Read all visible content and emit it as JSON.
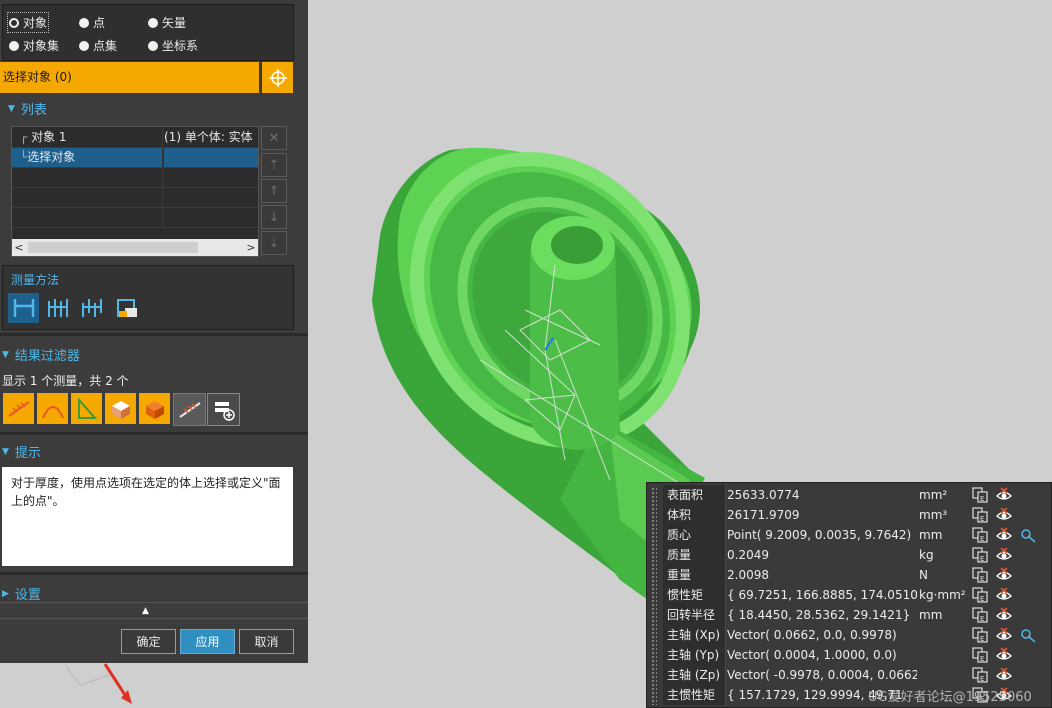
{
  "selection_types": [
    {
      "label": "对象",
      "checked": true
    },
    {
      "label": "点",
      "checked": false
    },
    {
      "label": "矢量",
      "checked": false
    },
    {
      "label": "对象集",
      "checked": false
    },
    {
      "label": "点集",
      "checked": false
    },
    {
      "label": "坐标系",
      "checked": false
    }
  ],
  "select_bar": {
    "label": "选择对象 (0)",
    "target_icon": "crosshair-icon"
  },
  "list_section": {
    "title": "列表",
    "rows": [
      {
        "name": "对象 1",
        "info": "(1) 单个体: 实体"
      },
      {
        "name": "选择对象",
        "info": ""
      }
    ],
    "side_buttons": [
      "delete-icon",
      "move-top-icon",
      "move-up-icon",
      "move-down-icon",
      "move-bottom-icon"
    ]
  },
  "method_section": {
    "title": "测量方法",
    "buttons": [
      "distance-icon",
      "multi-distance-icon",
      "chain-distance-icon",
      "mass-properties-icon"
    ]
  },
  "filter_section": {
    "title": "结果过滤器",
    "summary": "显示 1 个测量，共 2 个",
    "buttons": [
      "length-filter-icon",
      "arc-filter-icon",
      "angle-filter-icon",
      "area-filter-icon",
      "volume-filter-icon",
      "dimension-filter-icon",
      "add-filter-icon"
    ]
  },
  "hint_section": {
    "title": "提示",
    "text": "对于厚度，使用点选项在选定的体上选择或定义\"面上的点\"。"
  },
  "settings_section": {
    "title": "设置"
  },
  "buttons": {
    "ok": "确定",
    "apply": "应用",
    "cancel": "取消"
  },
  "properties": [
    {
      "name": "表面积",
      "value": "25633.0774",
      "unit": "mm²"
    },
    {
      "name": "体积",
      "value": "26171.9709",
      "unit": "mm³"
    },
    {
      "name": "质心",
      "value": "Point( 9.2009, 0.0035, 9.7642)",
      "unit": "mm"
    },
    {
      "name": "质量",
      "value": "0.2049",
      "unit": "kg"
    },
    {
      "name": "重量",
      "value": "2.0098",
      "unit": "N"
    },
    {
      "name": "惯性矩",
      "value": "{ 69.7251, 166.8885, 174.0510}",
      "unit": "kg·mm²"
    },
    {
      "name": "回转半径",
      "value": "{ 18.4450, 28.5362, 29.1421}",
      "unit": "mm"
    },
    {
      "name": "主轴 (Xp)",
      "value": "Vector( 0.0662, 0.0, 0.9978)",
      "unit": ""
    },
    {
      "name": "主轴 (Yp)",
      "value": "Vector( 0.0004, 1.0000, 0.0)",
      "unit": ""
    },
    {
      "name": "主轴 (Zp)",
      "value": "Vector( -0.9978, 0.0004, 0.0662)",
      "unit": ""
    },
    {
      "name": "主惯性矩",
      "value": "{ 157.1729, 129.9994, 49.71",
      "unit": ""
    }
  ],
  "watermark": "UG爱好者论坛@19525060",
  "colors": {
    "accent": "#f5a800",
    "model": "#55c84a",
    "panel": "#3c3c3c",
    "link": "#4fb8e8"
  }
}
